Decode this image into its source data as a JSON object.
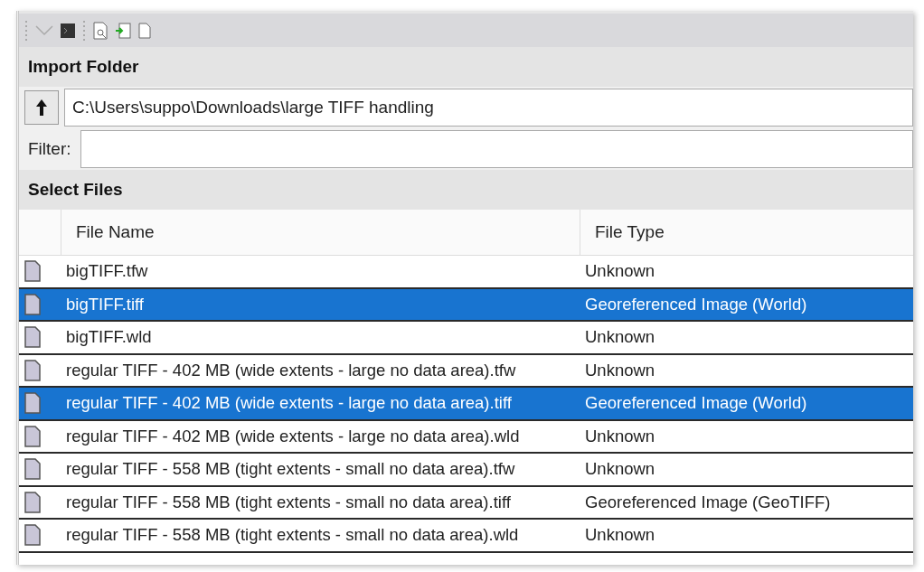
{
  "sections": {
    "import_folder": "Import Folder",
    "select_files": "Select Files"
  },
  "path_field": {
    "value": "C:\\Users\\suppo\\Downloads\\large TIFF handling"
  },
  "filter": {
    "label": "Filter:"
  },
  "table": {
    "columns": [
      "File Name",
      "File Type"
    ],
    "rows": [
      {
        "name": "bigTIFF.tfw",
        "type": "Unknown",
        "selected": false
      },
      {
        "name": "bigTIFF.tiff",
        "type": "Georeferenced Image (World)",
        "selected": true
      },
      {
        "name": "bigTIFF.wld",
        "type": "Unknown",
        "selected": false
      },
      {
        "name": "regular TIFF - 402 MB (wide extents - large no data area).tfw",
        "type": "Unknown",
        "selected": false
      },
      {
        "name": "regular TIFF - 402 MB (wide extents - large no data area).tiff",
        "type": "Georeferenced Image (World)",
        "selected": true
      },
      {
        "name": "regular TIFF - 402 MB (wide extents - large no data area).wld",
        "type": "Unknown",
        "selected": false
      },
      {
        "name": "regular TIFF - 558 MB (tight extents - small no data area).tfw",
        "type": "Unknown",
        "selected": false
      },
      {
        "name": "regular TIFF - 558 MB (tight extents - small no data area).tiff",
        "type": "Georeferenced Image (GeoTIFF)",
        "selected": false
      },
      {
        "name": "regular TIFF - 558 MB (tight extents - small no data area).wld",
        "type": "Unknown",
        "selected": false
      }
    ]
  }
}
